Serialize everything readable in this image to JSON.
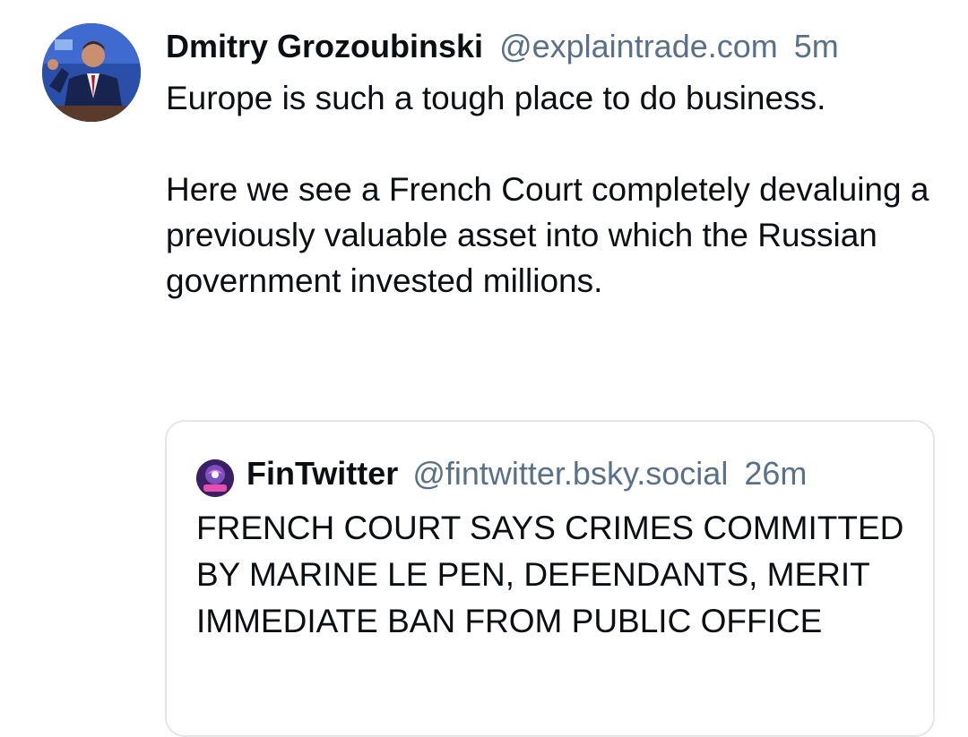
{
  "post": {
    "author_name": "Dmitry Grozoubinski",
    "author_handle": "@explaintrade.com",
    "timestamp": "5m",
    "paragraphs": [
      "Europe is such a tough place to do business.",
      "Here we see a French Court completely devaluing a previously valuable asset into which the Russian government invested millions."
    ]
  },
  "quote": {
    "author_name": "FinTwitter",
    "author_handle": "@fintwitter.bsky.social",
    "timestamp": "26m",
    "text": "FRENCH COURT SAYS CRIMES COMMITTED BY MARINE LE PEN, DEFENDANTS, MERIT IMMEDIATE BAN FROM PUBLIC OFFICE"
  },
  "colors": {
    "text": "#0b0f14",
    "muted": "#59708a",
    "border": "#e1e6ea"
  }
}
